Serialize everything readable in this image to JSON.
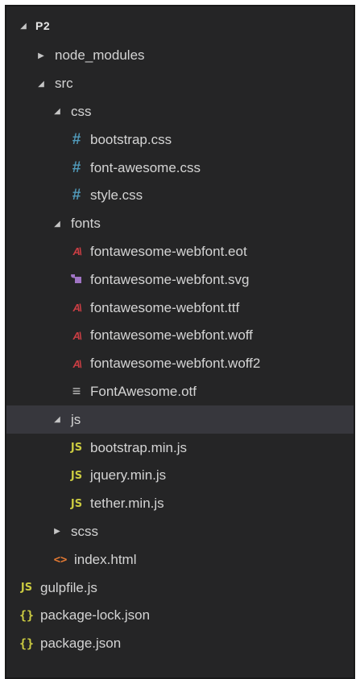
{
  "explorer": {
    "root_label": "P2",
    "items": [
      {
        "label": "node_modules",
        "kind": "folder",
        "expanded": false,
        "depth": 1
      },
      {
        "label": "src",
        "kind": "folder",
        "expanded": true,
        "depth": 1
      },
      {
        "label": "css",
        "kind": "folder",
        "expanded": true,
        "depth": 2
      },
      {
        "label": "bootstrap.css",
        "kind": "css",
        "depth": 3,
        "icon": "css-hash-icon"
      },
      {
        "label": "font-awesome.css",
        "kind": "css",
        "depth": 3,
        "icon": "css-hash-icon"
      },
      {
        "label": "style.css",
        "kind": "css",
        "depth": 3,
        "icon": "css-hash-icon"
      },
      {
        "label": "fonts",
        "kind": "folder",
        "expanded": true,
        "depth": 2
      },
      {
        "label": "fontawesome-webfont.eot",
        "kind": "font",
        "depth": 3,
        "icon": "font-a-icon"
      },
      {
        "label": "fontawesome-webfont.svg",
        "kind": "svg",
        "depth": 3,
        "icon": "svg-file-icon"
      },
      {
        "label": "fontawesome-webfont.ttf",
        "kind": "font",
        "depth": 3,
        "icon": "font-a-icon"
      },
      {
        "label": "fontawesome-webfont.woff",
        "kind": "font",
        "depth": 3,
        "icon": "font-a-icon"
      },
      {
        "label": "fontawesome-webfont.woff2",
        "kind": "font",
        "depth": 3,
        "icon": "font-a-icon"
      },
      {
        "label": "FontAwesome.otf",
        "kind": "otf",
        "depth": 3,
        "icon": "text-lines-icon"
      },
      {
        "label": "js",
        "kind": "folder",
        "expanded": true,
        "depth": 2,
        "selected": true
      },
      {
        "label": "bootstrap.min.js",
        "kind": "js",
        "depth": 3,
        "icon": "js-icon"
      },
      {
        "label": "jquery.min.js",
        "kind": "js",
        "depth": 3,
        "icon": "js-icon"
      },
      {
        "label": "tether.min.js",
        "kind": "js",
        "depth": 3,
        "icon": "js-icon"
      },
      {
        "label": "scss",
        "kind": "folder",
        "expanded": false,
        "depth": 2
      },
      {
        "label": "index.html",
        "kind": "html",
        "depth": 2,
        "icon": "html-brackets-icon"
      },
      {
        "label": "gulpfile.js",
        "kind": "js",
        "depth": 0,
        "icon": "js-icon"
      },
      {
        "label": "package-lock.json",
        "kind": "json",
        "depth": 0,
        "icon": "json-braces-icon"
      },
      {
        "label": "package.json",
        "kind": "json",
        "depth": 0,
        "icon": "json-braces-icon"
      }
    ],
    "glyphs": {
      "expanded": "◢",
      "collapsed": "▶",
      "css": "#",
      "font": "A\\",
      "otf": "≡",
      "js": "JS",
      "html": "<>",
      "json": "{}"
    },
    "colors": {
      "background": "#252526",
      "text": "#d4d4d4",
      "selected_row": "#37373d",
      "css_icon": "#519aba",
      "font_icon": "#cc3e44",
      "svg_icon": "#a074c4",
      "js_icon": "#cbcb41",
      "html_icon": "#e37933",
      "json_icon": "#cbcb41"
    }
  }
}
